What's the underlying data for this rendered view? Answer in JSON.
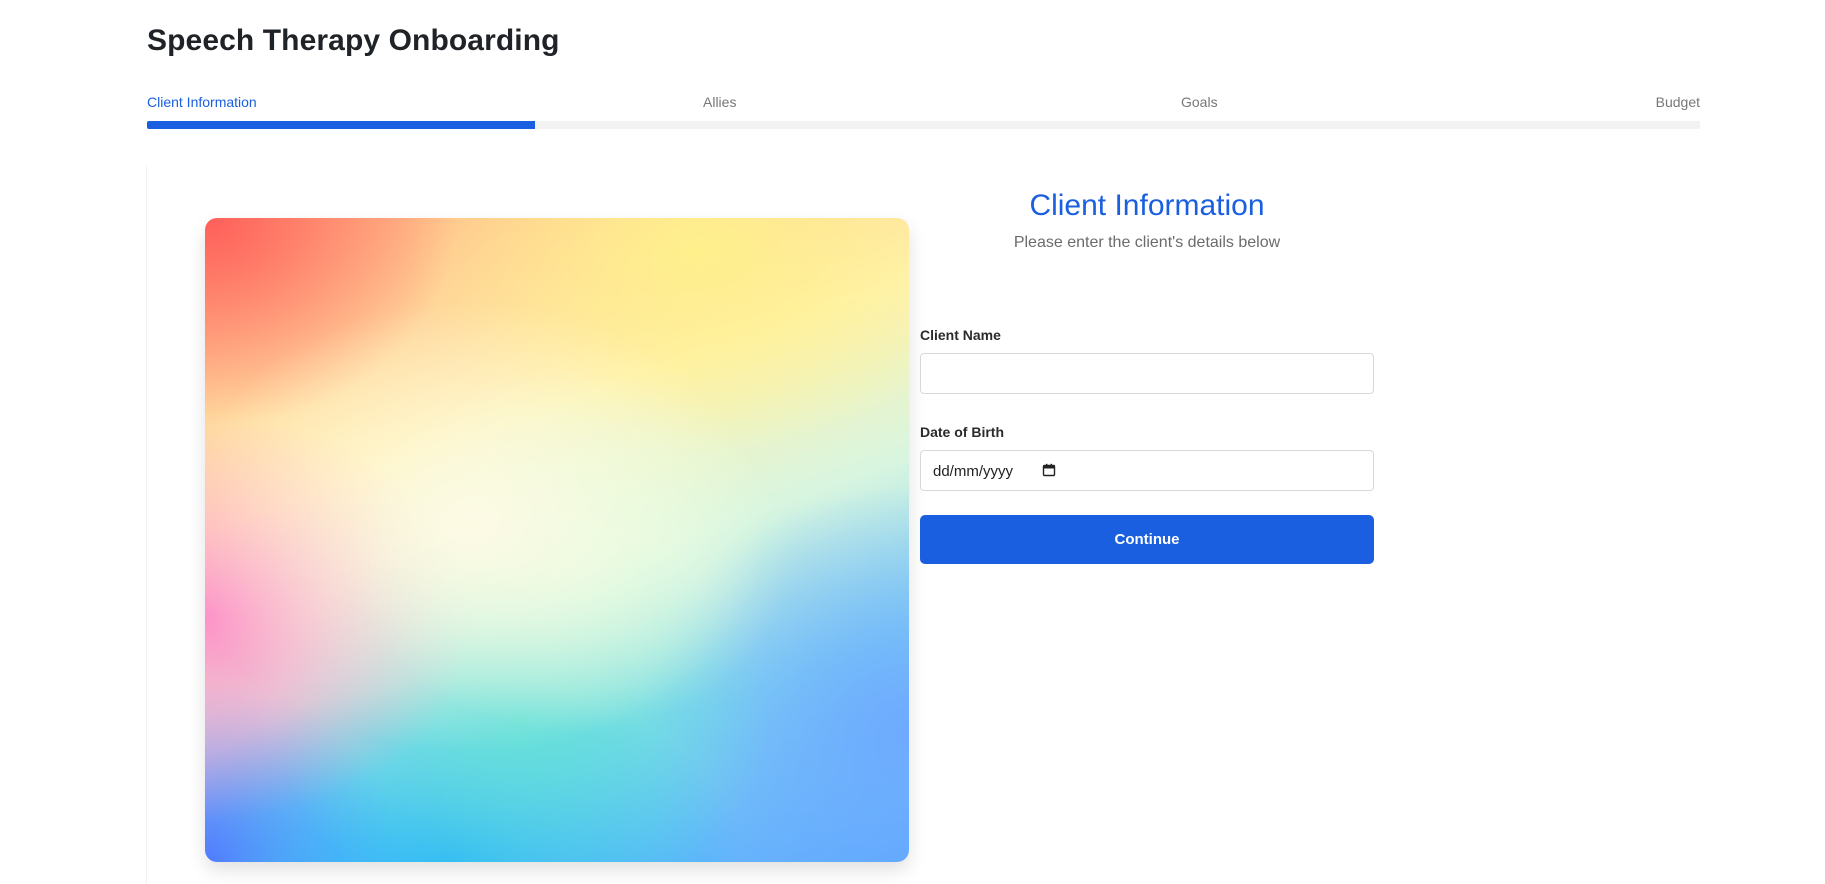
{
  "app": {
    "title": "Speech Therapy Onboarding"
  },
  "steps": [
    {
      "label": "Client Information",
      "active": true
    },
    {
      "label": "Allies",
      "active": false
    },
    {
      "label": "Goals",
      "active": false
    },
    {
      "label": "Budget",
      "active": false
    }
  ],
  "progress": {
    "current_step": 1,
    "total_steps": 4,
    "fraction": 0.25
  },
  "form": {
    "title": "Client Information",
    "subtitle": "Please enter the client's details below",
    "fields": {
      "client_name": {
        "label": "Client Name",
        "value": ""
      },
      "date_of_birth": {
        "label": "Date of Birth",
        "value": "",
        "placeholder": "dd/mm/yyyy"
      }
    },
    "continue_label": "Continue"
  },
  "hero_image": {
    "kind": "decorative-gradient"
  },
  "colors": {
    "accent": "#1a5fe0",
    "track": "#f2f2f2",
    "muted_text": "#777777"
  },
  "icons": {
    "date_picker": "calendar-icon"
  }
}
